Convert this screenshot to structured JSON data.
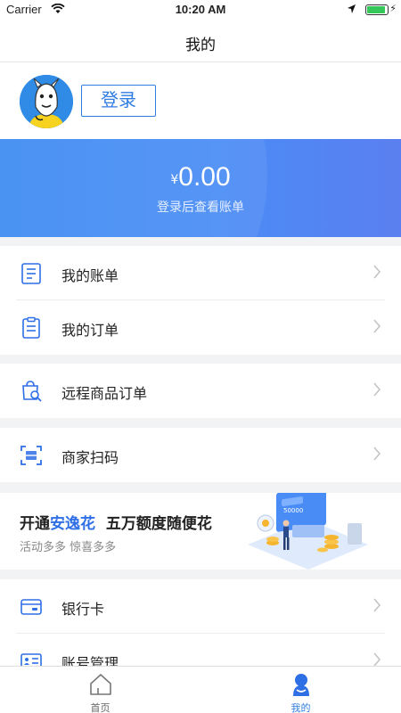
{
  "status_bar": {
    "carrier": "Carrier",
    "time": "10:20 AM",
    "battery_level": 0.9
  },
  "nav": {
    "title": "我的"
  },
  "profile": {
    "login_label": "登录"
  },
  "balance": {
    "currency_symbol": "¥",
    "amount": "0.00",
    "hint": "登录后查看账单"
  },
  "menu": {
    "bill": "我的账单",
    "order": "我的订单",
    "remote_order": "远程商品订单",
    "merchant_scan": "商家扫码",
    "bank_card": "银行卡",
    "account_mgmt": "账号管理"
  },
  "promo": {
    "headline_prefix": "开通",
    "headline_highlight": "安逸花",
    "headline_suffix": "五万额度随便花",
    "subline": "活动多多  惊喜多多",
    "card_amount": "50000"
  },
  "tabs": {
    "home": "首页",
    "mine": "我的"
  },
  "colors": {
    "accent": "#2f7de1",
    "banner_start": "#3d8bf3",
    "banner_end": "#5b7ff0"
  }
}
